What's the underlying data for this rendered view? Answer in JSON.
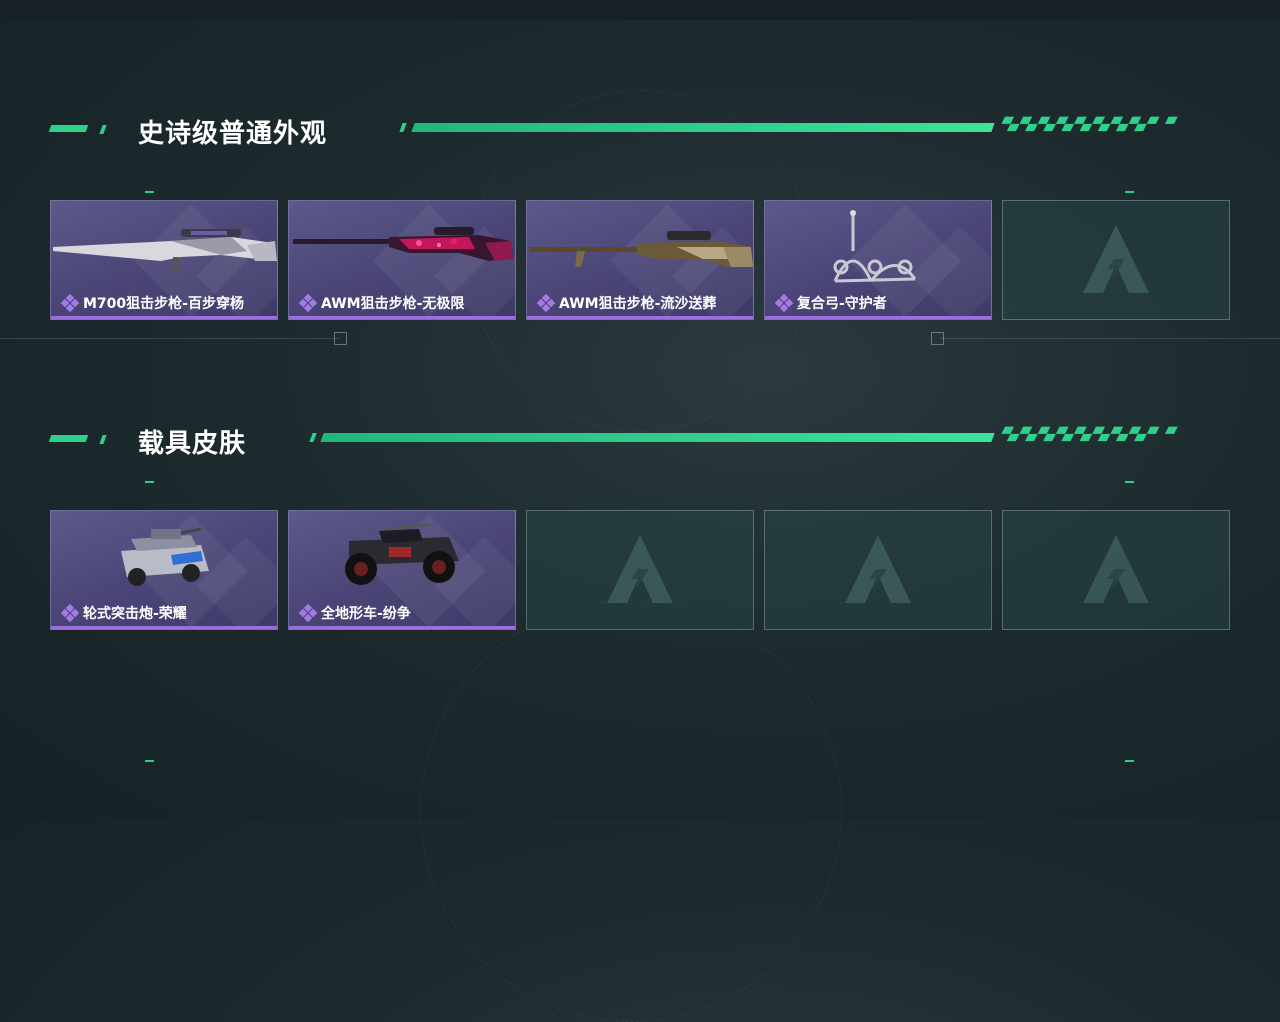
{
  "sections": [
    {
      "title": "史诗级普通外观",
      "items": [
        {
          "label": "M700狙击步枪-百步穿杨",
          "icon": "sniper-rifle-m700"
        },
        {
          "label": "AWM狙击步枪-无极限",
          "icon": "sniper-rifle-awm-red"
        },
        {
          "label": "AWM狙击步枪-流沙送葬",
          "icon": "sniper-rifle-awm-sand"
        },
        {
          "label": "复合弓-守护者",
          "icon": "compound-bow"
        },
        {
          "label": "",
          "icon": "empty-slot-logo"
        }
      ]
    },
    {
      "title": "载具皮肤",
      "items": [
        {
          "label": "轮式突击炮-荣耀",
          "icon": "armored-vehicle"
        },
        {
          "label": "全地形车-纷争",
          "icon": "atv"
        },
        {
          "label": "",
          "icon": "empty-slot-logo"
        },
        {
          "label": "",
          "icon": "empty-slot-logo"
        },
        {
          "label": "",
          "icon": "empty-slot-logo"
        }
      ]
    }
  ],
  "colors": {
    "accent": "#2ed18a",
    "rarity": "#9c6ee0",
    "card": "#4b4677"
  }
}
